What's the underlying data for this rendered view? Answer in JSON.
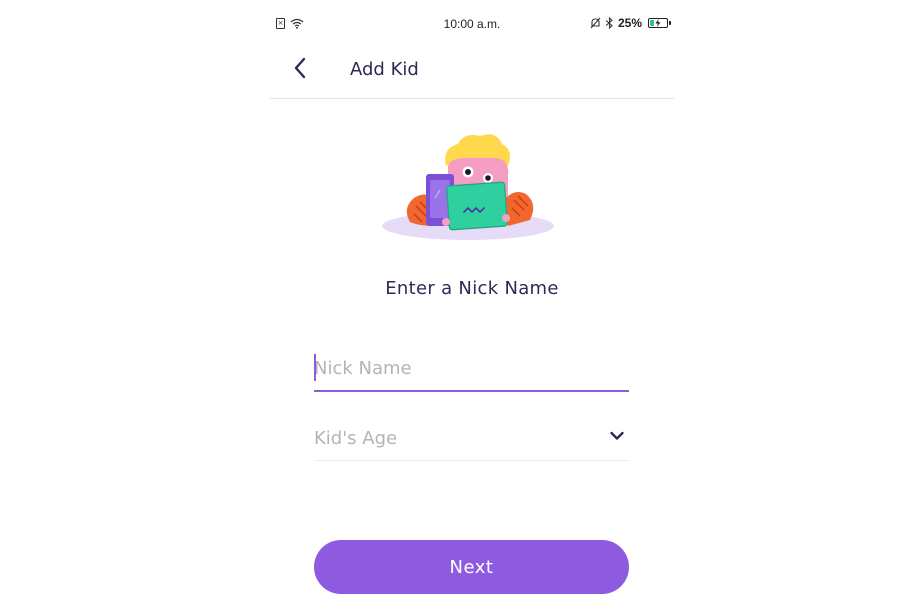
{
  "status_bar": {
    "time": "10:00 a.m.",
    "battery_percent": "25%",
    "battery_level": 0.25,
    "icons": [
      "sim-icon",
      "wifi-icon",
      "alarm-off-icon",
      "bluetooth-icon",
      "battery-charging-icon"
    ]
  },
  "app_bar": {
    "back_icon": "chevron-left-icon",
    "title": "Add Kid"
  },
  "illustration": {
    "icon": "kid-with-tablet-illustration"
  },
  "prompt": "Enter a Nick Name",
  "form": {
    "nick_name": {
      "placeholder": "Nick Name",
      "value": ""
    },
    "kids_age": {
      "placeholder": "Kid's Age",
      "icon": "chevron-down-icon"
    }
  },
  "next_button": {
    "label": "Next"
  },
  "colors": {
    "accent": "#8e5be0",
    "title_text": "#2d2b55",
    "placeholder": "#b4b4b4"
  }
}
